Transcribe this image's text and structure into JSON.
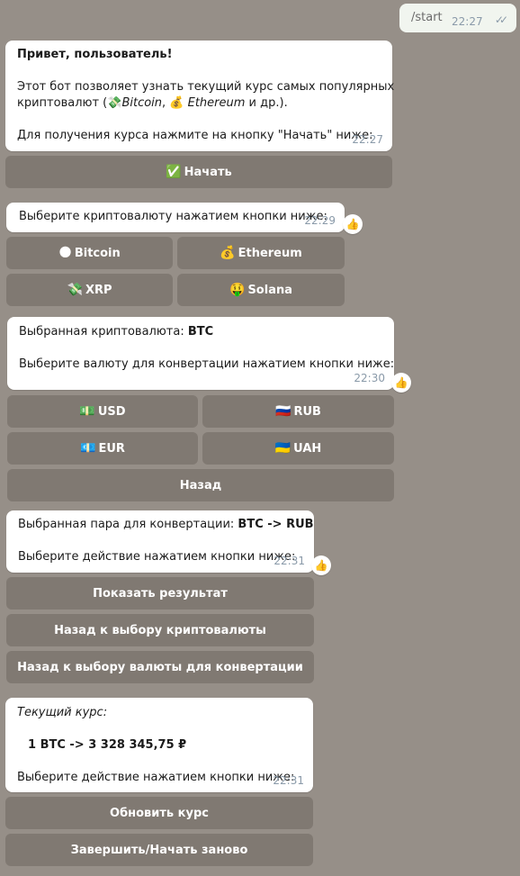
{
  "outgoing": {
    "text": "/start",
    "time": "22:27",
    "ticks": "✓✓"
  },
  "messages": {
    "welcome": {
      "greeting": "Привет, пользователь!",
      "line1": "Этот бот позволяет узнать текущий курс самых популярных",
      "line2_pre": "криптовалют (",
      "btc_icon": "💸",
      "btc_name": "Bitcoin",
      "sep": ", ",
      "eth_icon": "💰",
      "eth_name": "Ethereum",
      "line2_post": " и др.).",
      "line3": "Для получения курса нажмите на кнопку \"Начать\" ниже:",
      "time": "22:27"
    },
    "choose_crypto": {
      "text": "Выберите криптовалюту нажатием кнопки ниже:",
      "time": "22:29",
      "reaction": "👍"
    },
    "chosen_crypto": {
      "label": "Выбранная криптовалюта: ",
      "value": "BTC",
      "prompt": "Выберите валюту для конвертации нажатием кнопки ниже:",
      "time": "22:30",
      "reaction": "👍"
    },
    "chosen_pair": {
      "label": "Выбранная пара для конвертации: ",
      "value": "BTC -> RUB",
      "prompt": "Выберите действие нажатием кнопки ниже:",
      "time": "22:31",
      "reaction": "👍"
    },
    "rate": {
      "title": "Текущий курс:",
      "value": "1 BTC -> 3 328 345,75 ₽",
      "prompt": "Выберите действие нажатием кнопки ниже:",
      "time": "22:31"
    }
  },
  "buttons": {
    "start": {
      "icon": "✅",
      "label": "Начать"
    },
    "crypto": [
      {
        "icon": "🌑",
        "label": "Bitcoin"
      },
      {
        "icon": "💰",
        "label": "Ethereum"
      },
      {
        "icon": "💸",
        "label": "XRP"
      },
      {
        "icon": "🤑",
        "label": "Solana"
      }
    ],
    "currency": [
      {
        "icon": "💵",
        "label": "USD"
      },
      {
        "icon": "🇷🇺",
        "label": "RUB"
      },
      {
        "icon": "💶",
        "label": "EUR"
      },
      {
        "icon": "🇺🇦",
        "label": "UAH"
      }
    ],
    "back": "Назад",
    "show_result": "Показать результат",
    "back_crypto": "Назад к выбору криптовалюты",
    "back_currency": "Назад к выбору валюты для конвертации",
    "refresh": "Обновить курс",
    "finish": "Завершить/Начать заново"
  }
}
